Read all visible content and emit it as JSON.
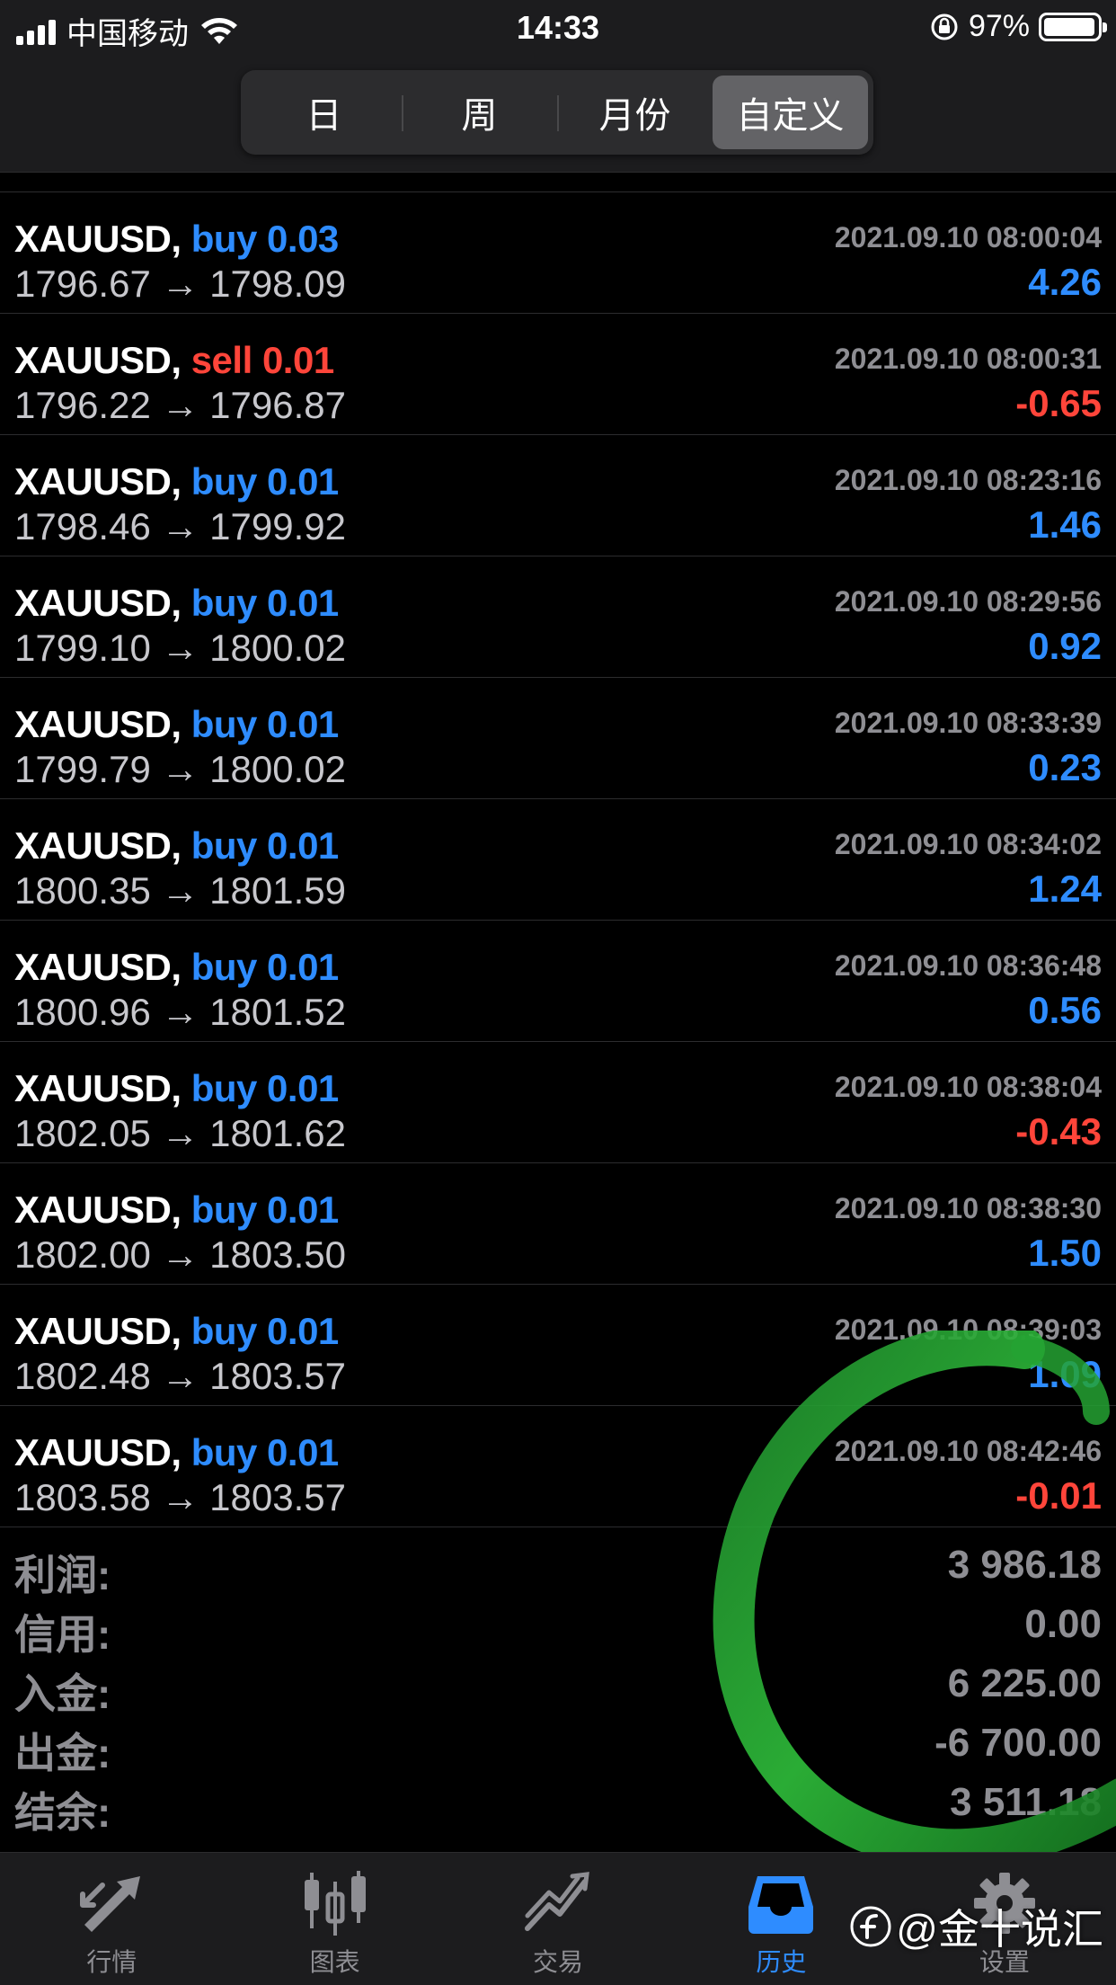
{
  "status_bar": {
    "carrier": "中国移动",
    "time": "14:33",
    "battery_percent": "97%",
    "battery_level": 0.97
  },
  "segmented": {
    "items": [
      {
        "label": "日",
        "active": false
      },
      {
        "label": "周",
        "active": false
      },
      {
        "label": "月份",
        "active": false
      },
      {
        "label": "自定义",
        "active": true
      }
    ]
  },
  "trades": [
    {
      "symbol": "XAUUSD,",
      "side": "buy",
      "volume": "0.03",
      "time": "2021.09.10 08:00:04",
      "open": "1796.67",
      "close": "1798.09",
      "profit": "4.26"
    },
    {
      "symbol": "XAUUSD,",
      "side": "sell",
      "volume": "0.01",
      "time": "2021.09.10 08:00:31",
      "open": "1796.22",
      "close": "1796.87",
      "profit": "-0.65"
    },
    {
      "symbol": "XAUUSD,",
      "side": "buy",
      "volume": "0.01",
      "time": "2021.09.10 08:23:16",
      "open": "1798.46",
      "close": "1799.92",
      "profit": "1.46"
    },
    {
      "symbol": "XAUUSD,",
      "side": "buy",
      "volume": "0.01",
      "time": "2021.09.10 08:29:56",
      "open": "1799.10",
      "close": "1800.02",
      "profit": "0.92"
    },
    {
      "symbol": "XAUUSD,",
      "side": "buy",
      "volume": "0.01",
      "time": "2021.09.10 08:33:39",
      "open": "1799.79",
      "close": "1800.02",
      "profit": "0.23"
    },
    {
      "symbol": "XAUUSD,",
      "side": "buy",
      "volume": "0.01",
      "time": "2021.09.10 08:34:02",
      "open": "1800.35",
      "close": "1801.59",
      "profit": "1.24"
    },
    {
      "symbol": "XAUUSD,",
      "side": "buy",
      "volume": "0.01",
      "time": "2021.09.10 08:36:48",
      "open": "1800.96",
      "close": "1801.52",
      "profit": "0.56"
    },
    {
      "symbol": "XAUUSD,",
      "side": "buy",
      "volume": "0.01",
      "time": "2021.09.10 08:38:04",
      "open": "1802.05",
      "close": "1801.62",
      "profit": "-0.43"
    },
    {
      "symbol": "XAUUSD,",
      "side": "buy",
      "volume": "0.01",
      "time": "2021.09.10 08:38:30",
      "open": "1802.00",
      "close": "1803.50",
      "profit": "1.50"
    },
    {
      "symbol": "XAUUSD,",
      "side": "buy",
      "volume": "0.01",
      "time": "2021.09.10 08:39:03",
      "open": "1802.48",
      "close": "1803.57",
      "profit": "1.09"
    },
    {
      "symbol": "XAUUSD,",
      "side": "buy",
      "volume": "0.01",
      "time": "2021.09.10 08:42:46",
      "open": "1803.58",
      "close": "1803.57",
      "profit": "-0.01"
    }
  ],
  "summary": [
    {
      "label": "利润:",
      "value": "3 986.18"
    },
    {
      "label": "信用:",
      "value": "0.00"
    },
    {
      "label": "入金:",
      "value": "6 225.00"
    },
    {
      "label": "出金:",
      "value": "-6 700.00"
    },
    {
      "label": "结余:",
      "value": "3 511.18"
    }
  ],
  "tabbar": {
    "items": [
      {
        "label": "行情",
        "icon": "quotes-arrows-icon",
        "active": false
      },
      {
        "label": "图表",
        "icon": "candlestick-chart-icon",
        "active": false
      },
      {
        "label": "交易",
        "icon": "trade-trend-icon",
        "active": false
      },
      {
        "label": "历史",
        "icon": "history-inbox-icon",
        "active": true
      },
      {
        "label": "设置",
        "icon": "gear-icon",
        "active": false
      }
    ]
  },
  "watermark": {
    "text": "@金十说汇"
  },
  "colors": {
    "buy": "#2e8cff",
    "sell": "#ff453a",
    "background": "#000000",
    "bar": "#1c1c1e"
  }
}
